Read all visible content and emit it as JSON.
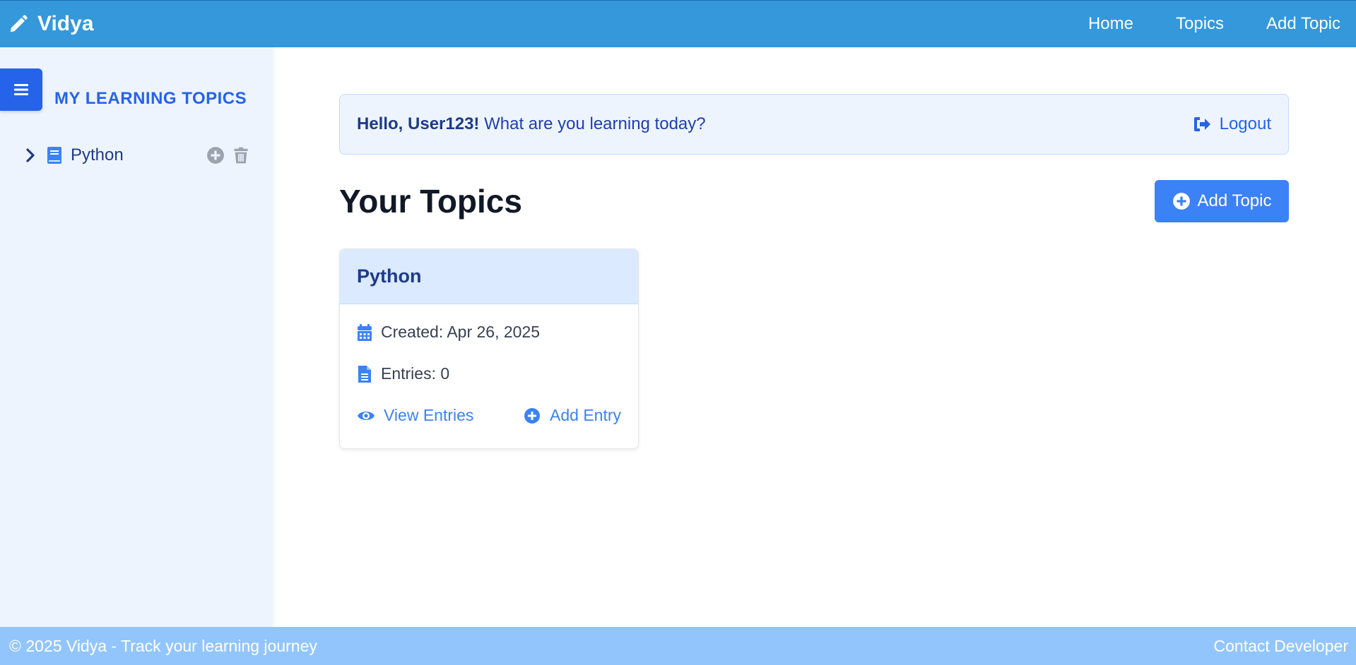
{
  "navbar": {
    "brand": "Vidya",
    "links": [
      "Home",
      "Topics",
      "Add Topic"
    ]
  },
  "sidebar": {
    "title": "MY LEARNING TOPICS",
    "items": [
      {
        "label": "Python"
      }
    ]
  },
  "greeting": {
    "hello": "Hello, User123!",
    "question": " What are you learning today?",
    "logout": "Logout"
  },
  "main": {
    "title": "Your Topics",
    "add_topic_label": "Add Topic"
  },
  "topics": [
    {
      "name": "Python",
      "created": "Created: Apr 26, 2025",
      "entries": "Entries: 0",
      "view_label": "View Entries",
      "add_label": "Add Entry"
    }
  ],
  "footer": {
    "copyright": "© 2025 Vidya - Track your learning journey",
    "contact": "Contact Developer"
  },
  "colors": {
    "navbar": "#3498db",
    "primary": "#3b82f6",
    "sidebar_bg": "#eef4fe",
    "footer": "#93c5fd"
  },
  "icons": {
    "brand": "pencil-icon",
    "toggle": "menu-icon",
    "logout": "sign-out-icon",
    "add": "plus-circle-icon",
    "calendar": "calendar-icon",
    "file": "file-icon",
    "eye": "eye-icon",
    "trash": "trash-icon",
    "book": "book-icon",
    "chevron": "chevron-right-icon"
  }
}
